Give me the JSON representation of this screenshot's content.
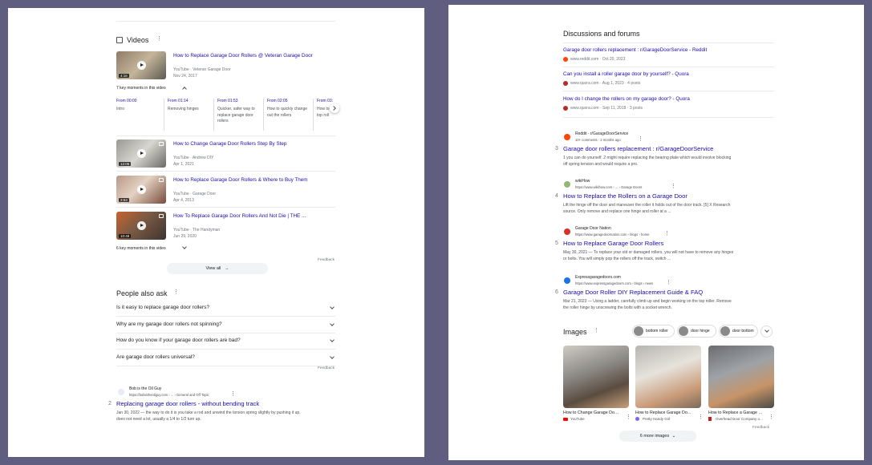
{
  "left": {
    "videos_title": "Videos",
    "videos": [
      {
        "title": "How to Replace Garage Door Rollers @ Veteran Garage Door",
        "channel": "YouTube · Veteran Garage Door",
        "date": "Nov 24, 2017",
        "duration": "4:16"
      },
      {
        "title": "How to Change Garage Door Rollers Step By Step",
        "channel": "YouTube · Andrew DIY",
        "date": "Apr 1, 2021",
        "duration": "12:05"
      },
      {
        "title": "How to Replace Garage Door Rollers & Where to Buy Them",
        "channel": "YouTube · Garage Door",
        "date": "Apr 4, 2013",
        "duration": "3:53"
      },
      {
        "title": "How To Replace Garage Door Rollers And Not Die | THE ...",
        "channel": "YouTube · The Handyman",
        "date": "Jun 29, 2020",
        "duration": "10:48"
      }
    ],
    "key_moments_label": "7 key moments in this video",
    "key_moments_label2": "6 key moments in this video",
    "key_moments": [
      {
        "time": "From 00:00",
        "text": "Intro"
      },
      {
        "time": "From 01:14",
        "text": "Removing hinges"
      },
      {
        "time": "From 01:53",
        "text": "Quicker, safer way to replace garage door rollers"
      },
      {
        "time": "From 02:05",
        "text": "How to quickly change out the rollers"
      },
      {
        "time": "From 03:",
        "text": "How to top roll"
      }
    ],
    "view_all": "View all",
    "feedback": "Feedback",
    "paa_title": "People also ask",
    "paa": [
      "Is it easy to replace garage door rollers?",
      "Why are my garage door rollers not spinning?",
      "How do you know if your garage door rollers are bad?",
      "Are garage door rollers universal?"
    ],
    "result2": {
      "site": "Bob is the Oil Guy",
      "url": "https://bobistheoilguy.com › ... › General and Off Topic",
      "number": "2",
      "title": "Replacing garage door rollers - without bending track",
      "snippet": "Jan 30, 2022 — the way to do it is you take a rod and unwind the torsion spring slightly by pushing it up. does not need a lot, usually a 1/4 to 1/2 turn up."
    }
  },
  "right": {
    "discussions_title": "Discussions and forums",
    "discussions": [
      {
        "title": "Garage door rollers replacement : r/GarageDoorService - Reddit",
        "meta": "www.reddit.com · Oct 20, 2023",
        "color": "#ff4500"
      },
      {
        "title": "Can you install a roller garage door by yourself? - Quora",
        "meta": "www.quora.com · Aug 1, 2023 · 4 posts",
        "color": "#b92b27"
      },
      {
        "title": "How do I change the rollers on my garage door? - Quora",
        "meta": "www.quora.com · Sep 11, 2018 · 3 posts",
        "color": "#b92b27"
      }
    ],
    "results": [
      {
        "site": "Reddit · r/GarageDoorService",
        "url": "10+ comments · 2 months ago",
        "number": "3",
        "title": "Garage door rollers replacement : r/GarageDoorService",
        "snippet_lines": [
          "1 you can do yourself. 2 might require replacing the bearing plate which would involve blocking",
          "off spring tension and would require a pro."
        ],
        "color": "#ff4500"
      },
      {
        "site": "wikiHow",
        "url": "https://www.wikihow.com › ... › Garage Doors",
        "number": "4",
        "title": "How to Replace the Rollers on a Garage Door",
        "snippet_lines": [
          "Lift the hinge off the door and maneuver the roller it holds out of the door track. [5] X Research",
          "source. Only remove and replace one hinge and roller at a ..."
        ],
        "color": "#93b874"
      },
      {
        "site": "Garage Door Nation",
        "url": "https://www.garagedoornation.com › blogs › home",
        "number": "5",
        "title": "How to Replace Garage Door Rollers",
        "snippet_lines": [
          "May 30, 2021 — To replace your old or damaged rollers, you will not have to remove any hinges",
          "or bolts. You will simply pop the rollers off the track, switch ..."
        ],
        "color": "#d93025"
      },
      {
        "site": "Expressgaragedoors.com",
        "url": "https://www.expressgaragedoors.com › blogs › news",
        "number": "6",
        "title": "Garage Door Roller DIY Replacement Guide & FAQ",
        "snippet_lines": [
          "Mar 21, 2023 — Using a ladder, carefully climb up and begin working on the top roller. Remove",
          "the roller hinge by unscrewing the bolts with a socket wrench."
        ],
        "color": "#1a73e8"
      }
    ],
    "images_title": "Images",
    "chips": [
      "bottom roller",
      "door hinge",
      "door bottom"
    ],
    "images": [
      {
        "caption": "How to Change Garage Door ...",
        "source": "YouTube",
        "color": "#ff0000"
      },
      {
        "caption": "How to Replace Garage Do...",
        "source": "Pretty Handy Girl",
        "color": "#7b68ee"
      },
      {
        "caption": "How to Replace a Garage D...",
        "source": "Overhead Door Company o...",
        "color": "#c5221f"
      }
    ],
    "more_images": "6 more images",
    "feedback": "Feedback"
  }
}
